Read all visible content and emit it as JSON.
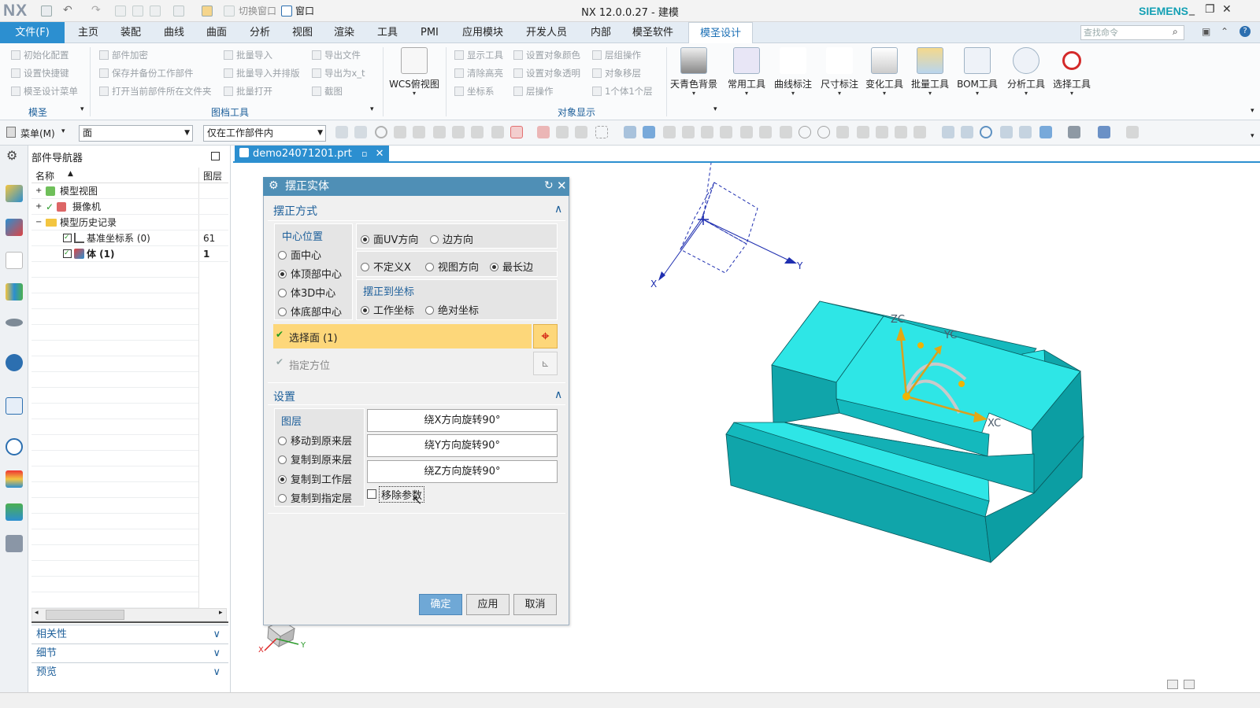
{
  "app": {
    "logo": "NX",
    "window_title": "NX 12.0.0.27 - 建模",
    "brand": "SIEMENS",
    "quick_access": {
      "switch_window": "切换窗口",
      "window": "窗口"
    },
    "window_controls": [
      "_",
      "❐",
      "✕"
    ]
  },
  "menu_tabs": {
    "file": "文件(F)",
    "tabs": [
      "主页",
      "装配",
      "曲线",
      "曲面",
      "分析",
      "视图",
      "渲染",
      "工具",
      "PMI",
      "应用模块",
      "开发人员",
      "内部",
      "模圣软件"
    ],
    "active": "模圣设计",
    "search_placeholder": "查找命令"
  },
  "ribbon": {
    "group1": {
      "items": [
        "初始化配置",
        "设置快捷键",
        "模圣设计菜单"
      ],
      "label": "模圣"
    },
    "group2": {
      "items": [
        "部件加密",
        "保存并备份工作部件",
        "打开当前部件所在文件夹",
        "批量导入",
        "批量导入并排版",
        "批量打开",
        "导出文件",
        "导出为x_t",
        "截图"
      ],
      "label": "图档工具"
    },
    "wcs": "WCS俯视图",
    "group3": {
      "items": [
        "显示工具",
        "清除高亮",
        "坐标系",
        "设置对象颜色",
        "设置对象透明",
        "层操作",
        "层组操作",
        "对象移层",
        "1个体1个层"
      ],
      "label": "对象显示"
    },
    "big_buttons": [
      "天青色背景",
      "常用工具",
      "曲线标注",
      "尺寸标注",
      "变化工具",
      "批量工具",
      "BOM工具",
      "分析工具",
      "选择工具"
    ]
  },
  "toolbar": {
    "menu": "菜单(M)",
    "filter": "面",
    "scope": "仅在工作部件内"
  },
  "navigator": {
    "title": "部件导航器",
    "col_name": "名称",
    "col_layer": "图层",
    "rows": [
      {
        "label": "模型视图",
        "layer": ""
      },
      {
        "label": "摄像机",
        "layer": ""
      },
      {
        "label": "模型历史记录",
        "layer": ""
      },
      {
        "label": "基准坐标系 (0)",
        "layer": "61"
      },
      {
        "label": "体 (1)",
        "layer": "1"
      }
    ],
    "sections": [
      "相关性",
      "细节",
      "预览"
    ]
  },
  "document": {
    "tab": "demo24071201.prt"
  },
  "dialog": {
    "title": "摆正实体",
    "section1": "摆正方式",
    "center_label": "中心位置",
    "center_options": [
      "面中心",
      "体顶部中心",
      "体3D中心",
      "体底部中心"
    ],
    "center_selected": 1,
    "dir_options": [
      "面UV方向",
      "边方向"
    ],
    "axis_options": [
      "不定义X",
      "视图方向",
      "最长边"
    ],
    "coord_label": "摆正到坐标",
    "coord_options": [
      "工作坐标",
      "绝对坐标"
    ],
    "select_face": "选择面 (1)",
    "specify_orient": "指定方位",
    "section2": "设置",
    "layer_label": "图层",
    "layer_options": [
      "移动到原来层",
      "复制到原来层",
      "复制到工作层",
      "复制到指定层"
    ],
    "layer_selected": 2,
    "rotate_buttons": [
      "绕X方向旋转90°",
      "绕Y方向旋转90°",
      "绕Z方向旋转90°"
    ],
    "remove_params": "移除参数",
    "ok": "确定",
    "apply": "应用",
    "cancel": "取消"
  },
  "viewport": {
    "csys_labels": {
      "x": "X",
      "y": "Y"
    },
    "wcs_labels": {
      "zc": "ZC",
      "yc": "YC",
      "xc": "XC"
    },
    "triad_labels": {
      "x": "X",
      "y": "Y"
    },
    "colors": {
      "part_top": "#2ee6e6",
      "part_side": "#14b9bd",
      "part_dark": "#0c9ea3",
      "accent": "#2c8fd0"
    }
  }
}
